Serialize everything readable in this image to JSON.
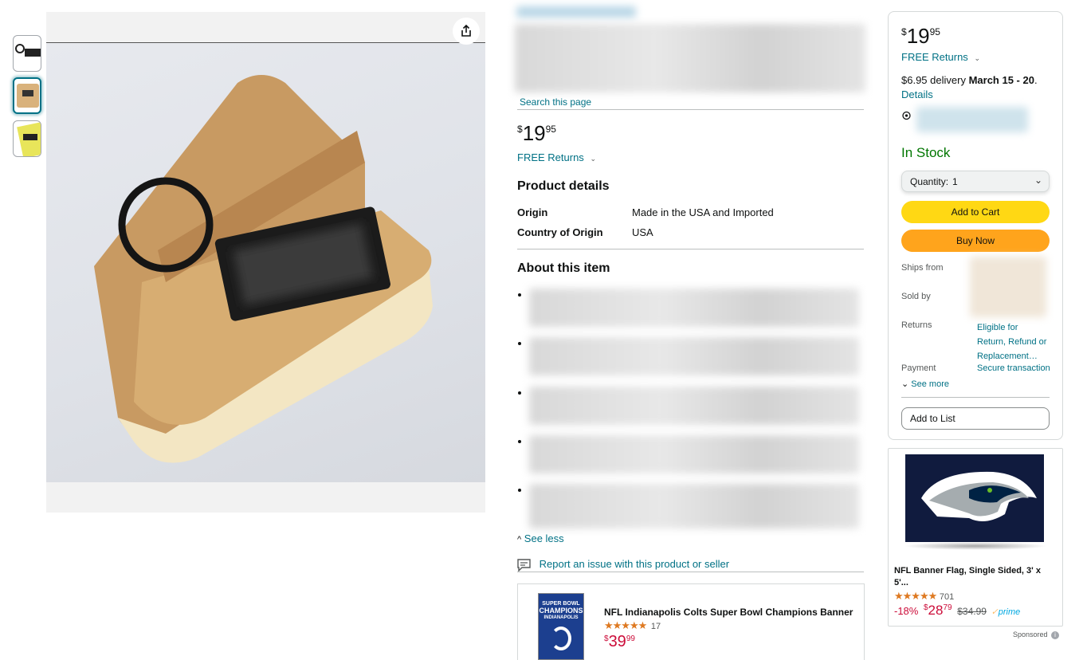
{
  "gallery": {
    "thumbnails": [
      "thumbnail-1",
      "thumbnail-2",
      "thumbnail-3"
    ],
    "active_index": 1
  },
  "product": {
    "search_link": "Search this page",
    "price": {
      "symbol": "$",
      "whole": "19",
      "fraction": "95"
    },
    "returns_link": "FREE Returns",
    "details_heading": "Product details",
    "details": [
      {
        "key": "Origin",
        "value": "Made in the USA and Imported"
      },
      {
        "key": "Country of Origin",
        "value": "USA"
      }
    ],
    "about_heading": "About this item",
    "see_less": "See less",
    "report_link": "Report an issue with this product or seller"
  },
  "buybox": {
    "price": {
      "symbol": "$",
      "whole": "19",
      "fraction": "95"
    },
    "returns_link": "FREE Returns",
    "delivery_prefix": "$6.95 delivery",
    "delivery_date": "March 15 - 20",
    "delivery_suffix": ".",
    "details_link": "Details",
    "stock": "In Stock",
    "quantity_label": "Quantity:",
    "quantity_value": "1",
    "add_to_cart": "Add to Cart",
    "buy_now": "Buy Now",
    "ships_from_label": "Ships from",
    "sold_by_label": "Sold by",
    "returns_label": "Returns",
    "returns_value_1": "Eligible for",
    "returns_value_2": "Return, Refund or",
    "returns_value_3": "Replacement…",
    "payment_label": "Payment",
    "payment_value": "Secure transaction",
    "see_more": "See more",
    "add_to_list": "Add to List"
  },
  "ad": {
    "title_1": "NFL Banner Flag, Single Sided, 3' x",
    "title_2": "5'...",
    "stars": "★★★★★",
    "review_count": "701",
    "discount": "-18%",
    "price_symbol": "$",
    "price_whole": "28",
    "price_fraction": "79",
    "list_price": "$34.99",
    "prime": "prime",
    "sponsored": "Sponsored"
  },
  "bottom_product": {
    "title": "NFL Indianapolis Colts Super Bowl Champions Banner",
    "stars": "★★★★★",
    "review_count": "17",
    "price_symbol": "$",
    "price_whole": "39",
    "price_fraction": "99",
    "banner_line_1": "SUPER BOWL",
    "banner_line_2": "CHAMPIONS",
    "banner_line_3": "INDIANAPOLIS"
  },
  "colors": {
    "link": "#007185",
    "stock_green": "#007600",
    "button_yellow": "#ffd814",
    "button_orange": "#ffa41c",
    "deal_red": "#cc0c39",
    "star_orange": "#de7921"
  }
}
